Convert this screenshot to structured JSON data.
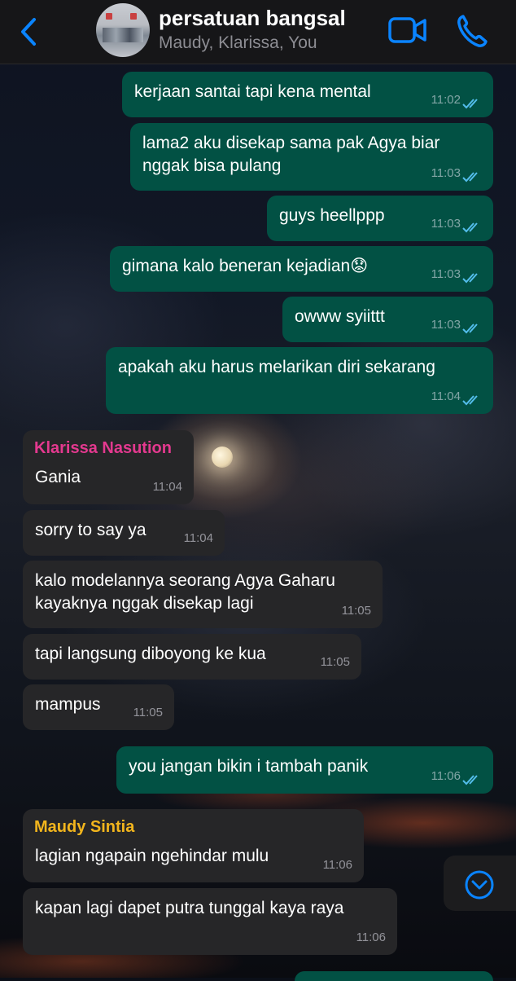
{
  "header": {
    "title": "persatuan bangsal",
    "subtitle": "Maudy, Klarissa, You",
    "back_icon": "chevron-left-icon",
    "video_icon": "video-camera-icon",
    "call_icon": "phone-icon",
    "accent_color": "#0a84ff"
  },
  "colors": {
    "outgoing_bubble": "#025144",
    "incoming_bubble": "#262628",
    "klarissa_name": "#e4398f",
    "maudy_name": "#f2b51d",
    "read_ticks": "#53bdeb"
  },
  "messages": [
    {
      "dir": "out",
      "text": "kerjaan santai tapi kena mental",
      "time": "11:02"
    },
    {
      "dir": "out",
      "text": "lama2 aku disekap sama pak Agya biar nggak bisa pulang",
      "time": "11:03"
    },
    {
      "dir": "out",
      "text": "guys heellppp",
      "time": "11:03"
    },
    {
      "dir": "out",
      "text": "gimana kalo beneran kejadian😟",
      "time": "11:03"
    },
    {
      "dir": "out",
      "text": "owww syiittt",
      "time": "11:03"
    },
    {
      "dir": "out",
      "text": "apakah aku harus melarikan diri sekarang",
      "time": "11:04"
    },
    {
      "dir": "in",
      "sender": "Klarissa Nasution",
      "text": "Gania",
      "time": "11:04"
    },
    {
      "dir": "in",
      "text": "sorry to say ya",
      "time": "11:04"
    },
    {
      "dir": "in",
      "text": "kalo modelannya seorang Agya Gaharu kayaknya nggak disekap lagi",
      "time": "11:05"
    },
    {
      "dir": "in",
      "text": "tapi langsung diboyong ke kua",
      "time": "11:05"
    },
    {
      "dir": "in",
      "text": "mampus",
      "time": "11:05"
    },
    {
      "dir": "out",
      "text": "you jangan bikin i tambah panik",
      "time": "11:06"
    },
    {
      "dir": "in",
      "sender": "Maudy Sintia",
      "text": "lagian ngapain ngehindar mulu",
      "time": "11:06"
    },
    {
      "dir": "in",
      "text": "kapan lagi dapet putra tunggal kaya raya",
      "time": "11:06"
    }
  ],
  "scroll_down_icon": "chevron-down-circle-icon"
}
